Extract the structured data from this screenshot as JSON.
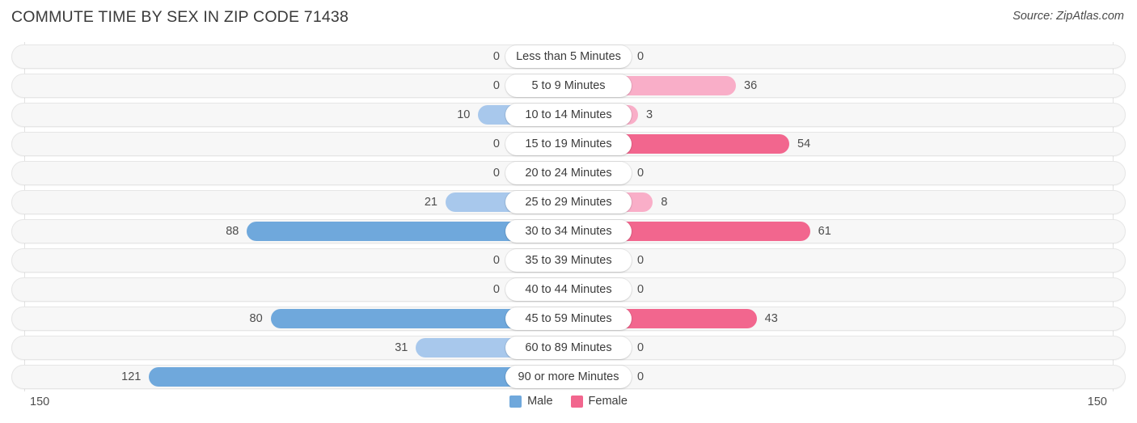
{
  "header": {
    "title": "COMMUTE TIME BY SEX IN ZIP CODE 71438",
    "source": "Source: ZipAtlas.com"
  },
  "legend": {
    "male_label": "Male",
    "female_label": "Female"
  },
  "axis": {
    "left_label": "150",
    "right_label": "150"
  },
  "colors": {
    "male_strong": "#6fa8dc",
    "male_pale": "#a8c8ec",
    "female_strong": "#f2668e",
    "female_pale": "#f9aec8",
    "track_bg": "#f7f7f7",
    "track_border": "#e6e6e6",
    "gridline": "#e2e2e2",
    "title": "#3a3a3a"
  },
  "chart_data": {
    "type": "bar",
    "subtype": "diverging-bidirectional-bar",
    "title": "COMMUTE TIME BY SEX IN ZIP CODE 71438",
    "xlabel": "",
    "ylabel": "",
    "xlim": [
      150,
      150
    ],
    "axis_max": 150,
    "grid": true,
    "legend_position": "bottom-center",
    "categories": [
      "Less than 5 Minutes",
      "5 to 9 Minutes",
      "10 to 14 Minutes",
      "15 to 19 Minutes",
      "20 to 24 Minutes",
      "25 to 29 Minutes",
      "30 to 34 Minutes",
      "35 to 39 Minutes",
      "40 to 44 Minutes",
      "45 to 59 Minutes",
      "60 to 89 Minutes",
      "90 or more Minutes"
    ],
    "series": [
      {
        "name": "Male",
        "direction": "left",
        "values": [
          0,
          0,
          10,
          0,
          0,
          21,
          88,
          0,
          0,
          80,
          31,
          121
        ]
      },
      {
        "name": "Female",
        "direction": "right",
        "values": [
          0,
          36,
          3,
          54,
          0,
          8,
          61,
          0,
          0,
          43,
          0,
          0
        ]
      }
    ]
  }
}
